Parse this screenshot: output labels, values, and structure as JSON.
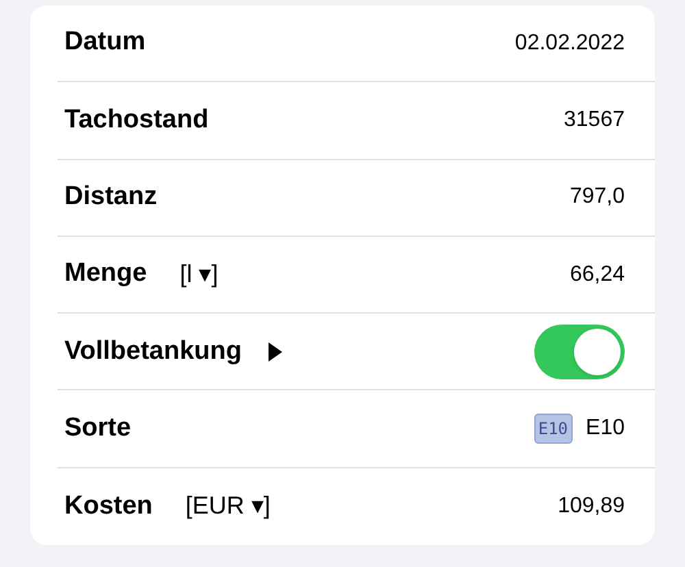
{
  "rows": [
    {
      "kind": "text",
      "label": "Datum",
      "value": "02.02.2022"
    },
    {
      "kind": "text",
      "label": "Tachostand",
      "value": "31567"
    },
    {
      "kind": "text",
      "label": "Distanz",
      "value": "797,0"
    },
    {
      "kind": "unit",
      "label": "Menge",
      "unit": "[l ▾]",
      "value": "66,24"
    },
    {
      "kind": "toggle",
      "label": "Vollbetankung",
      "on": true
    },
    {
      "kind": "badge",
      "label": "Sorte",
      "badge": "E10",
      "value": "E10"
    },
    {
      "kind": "unit",
      "label": "Kosten",
      "unit": "[EUR ▾]",
      "value": "109,89"
    }
  ]
}
